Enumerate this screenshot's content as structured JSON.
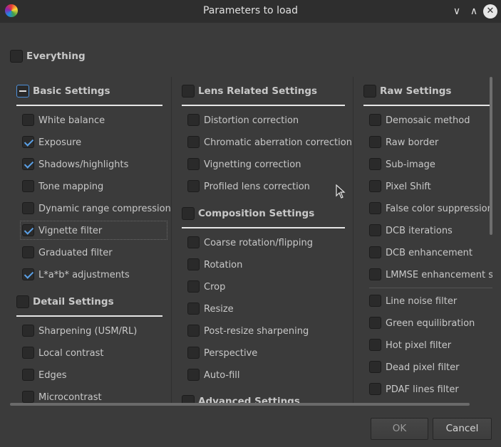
{
  "window": {
    "title": "Parameters to load"
  },
  "everything": {
    "label": "Everything",
    "checked": false
  },
  "columns": [
    {
      "sections": [
        {
          "title": "Basic Settings",
          "state": "partial",
          "items": [
            {
              "label": "White balance",
              "checked": false
            },
            {
              "label": "Exposure",
              "checked": true
            },
            {
              "label": "Shadows/highlights",
              "checked": true
            },
            {
              "label": "Tone mapping",
              "checked": false
            },
            {
              "label": "Dynamic range compression",
              "checked": false
            },
            {
              "label": "Vignette filter",
              "checked": true,
              "focused": true
            },
            {
              "label": "Graduated filter",
              "checked": false
            },
            {
              "label": "L*a*b* adjustments",
              "checked": true
            }
          ]
        },
        {
          "title": "Detail Settings",
          "state": "unchecked",
          "items": [
            {
              "label": "Sharpening (USM/RL)",
              "checked": false
            },
            {
              "label": "Local contrast",
              "checked": false
            },
            {
              "label": "Edges",
              "checked": false
            },
            {
              "label": "Microcontrast",
              "checked": false
            }
          ]
        }
      ]
    },
    {
      "sections": [
        {
          "title": "Lens Related Settings",
          "state": "unchecked",
          "items": [
            {
              "label": "Distortion correction",
              "checked": false
            },
            {
              "label": "Chromatic aberration correction",
              "checked": false
            },
            {
              "label": "Vignetting correction",
              "checked": false
            },
            {
              "label": "Profiled lens correction",
              "checked": false
            }
          ]
        },
        {
          "title": "Composition Settings",
          "state": "unchecked",
          "items": [
            {
              "label": "Coarse rotation/flipping",
              "checked": false
            },
            {
              "label": "Rotation",
              "checked": false
            },
            {
              "label": "Crop",
              "checked": false
            },
            {
              "label": "Resize",
              "checked": false
            },
            {
              "label": "Post-resize sharpening",
              "checked": false
            },
            {
              "label": "Perspective",
              "checked": false
            },
            {
              "label": "Auto-fill",
              "checked": false
            }
          ]
        },
        {
          "title": "Advanced Settings",
          "state": "unchecked",
          "items": []
        }
      ]
    },
    {
      "sections": [
        {
          "title": "Raw Settings",
          "state": "unchecked",
          "items": [
            {
              "label": "Demosaic method",
              "checked": false
            },
            {
              "label": "Raw border",
              "checked": false
            },
            {
              "label": "Sub-image",
              "checked": false
            },
            {
              "label": "Pixel Shift",
              "checked": false
            },
            {
              "label": "False color suppression",
              "checked": false
            },
            {
              "label": "DCB iterations",
              "checked": false
            },
            {
              "label": "DCB enhancement",
              "checked": false
            },
            {
              "label": "LMMSE enhancement steps",
              "checked": false
            },
            {
              "label": "Line noise filter",
              "checked": false
            },
            {
              "label": "Green equilibration",
              "checked": false
            },
            {
              "label": "Hot pixel filter",
              "checked": false
            },
            {
              "label": "Dead pixel filter",
              "checked": false
            },
            {
              "label": "PDAF lines filter",
              "checked": false
            }
          ]
        }
      ]
    }
  ],
  "buttons": {
    "ok": "OK",
    "cancel": "Cancel"
  },
  "icons": {
    "app": "rawtherapee-logo-icon",
    "minimize": "chevron-down-icon",
    "maximize": "chevron-up-icon",
    "close": "close-icon",
    "cursor": "mouse-pointer-icon"
  }
}
